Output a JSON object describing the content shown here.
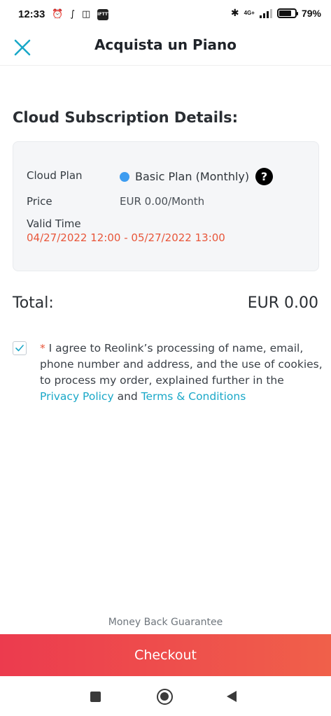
{
  "status_bar": {
    "time": "12:33",
    "left_icons": [
      "alarm-icon",
      "reolink-icon",
      "train-icon",
      "ifttt-icon"
    ],
    "ifttt_label": "IFTTT",
    "network": "4G+",
    "battery_percent": "79%",
    "battery_level": 0.79
  },
  "header": {
    "title": "Acquista un Piano",
    "close_icon": "close-icon",
    "accent_color": "#1aa8c8"
  },
  "details": {
    "title": "Cloud Subscription Details:",
    "plan_label": "Cloud Plan",
    "plan_name": "Basic Plan (Monthly)",
    "plan_dot_color": "#3d9cf0",
    "help_icon": "?",
    "price_label": "Price",
    "price_value": "EUR 0.00/Month",
    "valid_label": "Valid Time",
    "valid_range": "04/27/2022 12:00 - 05/27/2022 13:00"
  },
  "total": {
    "label": "Total:",
    "value": "EUR 0.00"
  },
  "agreement": {
    "checked": true,
    "required_mark": "*",
    "text": " I agree to Reolink’s processing of name, email, phone number and address, and the use of cookies, to process my order, explained further in the ",
    "privacy_link": "Privacy Policy",
    "and_text": " and ",
    "terms_link": "Terms & Conditions"
  },
  "footer": {
    "guarantee": "Money Back Guarantee",
    "checkout_label": "Checkout",
    "checkout_colors": [
      "#ec3b4e",
      "#f0604a"
    ]
  }
}
